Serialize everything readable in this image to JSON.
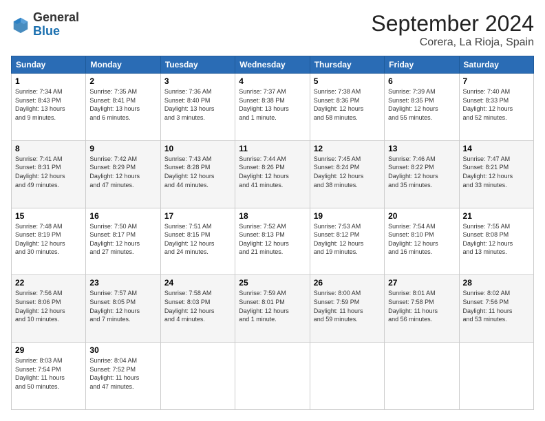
{
  "header": {
    "logo_general": "General",
    "logo_blue": "Blue",
    "month_title": "September 2024",
    "location": "Corera, La Rioja, Spain"
  },
  "days_of_week": [
    "Sunday",
    "Monday",
    "Tuesday",
    "Wednesday",
    "Thursday",
    "Friday",
    "Saturday"
  ],
  "weeks": [
    [
      {
        "day": "1",
        "info": "Sunrise: 7:34 AM\nSunset: 8:43 PM\nDaylight: 13 hours\nand 9 minutes."
      },
      {
        "day": "2",
        "info": "Sunrise: 7:35 AM\nSunset: 8:41 PM\nDaylight: 13 hours\nand 6 minutes."
      },
      {
        "day": "3",
        "info": "Sunrise: 7:36 AM\nSunset: 8:40 PM\nDaylight: 13 hours\nand 3 minutes."
      },
      {
        "day": "4",
        "info": "Sunrise: 7:37 AM\nSunset: 8:38 PM\nDaylight: 13 hours\nand 1 minute."
      },
      {
        "day": "5",
        "info": "Sunrise: 7:38 AM\nSunset: 8:36 PM\nDaylight: 12 hours\nand 58 minutes."
      },
      {
        "day": "6",
        "info": "Sunrise: 7:39 AM\nSunset: 8:35 PM\nDaylight: 12 hours\nand 55 minutes."
      },
      {
        "day": "7",
        "info": "Sunrise: 7:40 AM\nSunset: 8:33 PM\nDaylight: 12 hours\nand 52 minutes."
      }
    ],
    [
      {
        "day": "8",
        "info": "Sunrise: 7:41 AM\nSunset: 8:31 PM\nDaylight: 12 hours\nand 49 minutes."
      },
      {
        "day": "9",
        "info": "Sunrise: 7:42 AM\nSunset: 8:29 PM\nDaylight: 12 hours\nand 47 minutes."
      },
      {
        "day": "10",
        "info": "Sunrise: 7:43 AM\nSunset: 8:28 PM\nDaylight: 12 hours\nand 44 minutes."
      },
      {
        "day": "11",
        "info": "Sunrise: 7:44 AM\nSunset: 8:26 PM\nDaylight: 12 hours\nand 41 minutes."
      },
      {
        "day": "12",
        "info": "Sunrise: 7:45 AM\nSunset: 8:24 PM\nDaylight: 12 hours\nand 38 minutes."
      },
      {
        "day": "13",
        "info": "Sunrise: 7:46 AM\nSunset: 8:22 PM\nDaylight: 12 hours\nand 35 minutes."
      },
      {
        "day": "14",
        "info": "Sunrise: 7:47 AM\nSunset: 8:21 PM\nDaylight: 12 hours\nand 33 minutes."
      }
    ],
    [
      {
        "day": "15",
        "info": "Sunrise: 7:48 AM\nSunset: 8:19 PM\nDaylight: 12 hours\nand 30 minutes."
      },
      {
        "day": "16",
        "info": "Sunrise: 7:50 AM\nSunset: 8:17 PM\nDaylight: 12 hours\nand 27 minutes."
      },
      {
        "day": "17",
        "info": "Sunrise: 7:51 AM\nSunset: 8:15 PM\nDaylight: 12 hours\nand 24 minutes."
      },
      {
        "day": "18",
        "info": "Sunrise: 7:52 AM\nSunset: 8:13 PM\nDaylight: 12 hours\nand 21 minutes."
      },
      {
        "day": "19",
        "info": "Sunrise: 7:53 AM\nSunset: 8:12 PM\nDaylight: 12 hours\nand 19 minutes."
      },
      {
        "day": "20",
        "info": "Sunrise: 7:54 AM\nSunset: 8:10 PM\nDaylight: 12 hours\nand 16 minutes."
      },
      {
        "day": "21",
        "info": "Sunrise: 7:55 AM\nSunset: 8:08 PM\nDaylight: 12 hours\nand 13 minutes."
      }
    ],
    [
      {
        "day": "22",
        "info": "Sunrise: 7:56 AM\nSunset: 8:06 PM\nDaylight: 12 hours\nand 10 minutes."
      },
      {
        "day": "23",
        "info": "Sunrise: 7:57 AM\nSunset: 8:05 PM\nDaylight: 12 hours\nand 7 minutes."
      },
      {
        "day": "24",
        "info": "Sunrise: 7:58 AM\nSunset: 8:03 PM\nDaylight: 12 hours\nand 4 minutes."
      },
      {
        "day": "25",
        "info": "Sunrise: 7:59 AM\nSunset: 8:01 PM\nDaylight: 12 hours\nand 1 minute."
      },
      {
        "day": "26",
        "info": "Sunrise: 8:00 AM\nSunset: 7:59 PM\nDaylight: 11 hours\nand 59 minutes."
      },
      {
        "day": "27",
        "info": "Sunrise: 8:01 AM\nSunset: 7:58 PM\nDaylight: 11 hours\nand 56 minutes."
      },
      {
        "day": "28",
        "info": "Sunrise: 8:02 AM\nSunset: 7:56 PM\nDaylight: 11 hours\nand 53 minutes."
      }
    ],
    [
      {
        "day": "29",
        "info": "Sunrise: 8:03 AM\nSunset: 7:54 PM\nDaylight: 11 hours\nand 50 minutes."
      },
      {
        "day": "30",
        "info": "Sunrise: 8:04 AM\nSunset: 7:52 PM\nDaylight: 11 hours\nand 47 minutes."
      },
      null,
      null,
      null,
      null,
      null
    ]
  ]
}
